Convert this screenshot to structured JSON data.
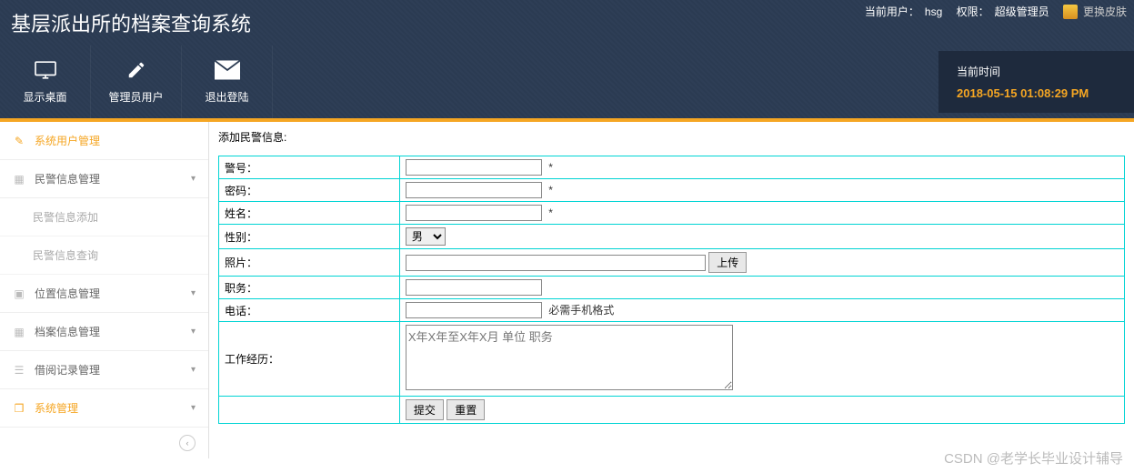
{
  "header": {
    "title": "基层派出所的档案查询系统",
    "user_label": "当前用户：",
    "user": "hsg",
    "role_label": "权限：",
    "role": "超级管理员",
    "skin_label": "更换皮肤"
  },
  "toolbar": {
    "desktop": "显示桌面",
    "admin_user": "管理员用户",
    "logout": "退出登陆"
  },
  "time_panel": {
    "label": "当前时间",
    "value": "2018-05-15 01:08:29 PM"
  },
  "sidebar": {
    "items": [
      {
        "label": "系统用户管理",
        "expandable": false,
        "active": true
      },
      {
        "label": "民警信息管理",
        "expandable": true
      },
      {
        "label": "位置信息管理",
        "expandable": true
      },
      {
        "label": "档案信息管理",
        "expandable": true
      },
      {
        "label": "借阅记录管理",
        "expandable": true
      },
      {
        "label": "系统管理",
        "expandable": true,
        "orange": true
      }
    ],
    "sub_items": [
      "民警信息添加",
      "民警信息查询"
    ]
  },
  "form": {
    "title": "添加民警信息:",
    "fields": {
      "police_no": "警号：",
      "password": "密码：",
      "name": "姓名：",
      "gender": "性别：",
      "gender_value": "男",
      "photo": "照片：",
      "upload": "上传",
      "position": "职务：",
      "phone": "电话：",
      "phone_hint": "必需手机格式",
      "work_history": "工作经历：",
      "work_history_value": "X年X年至X年X月 单位 职务",
      "required": "*",
      "submit": "提交",
      "reset": "重置"
    }
  },
  "watermark": "CSDN @老学长毕业设计辅导"
}
